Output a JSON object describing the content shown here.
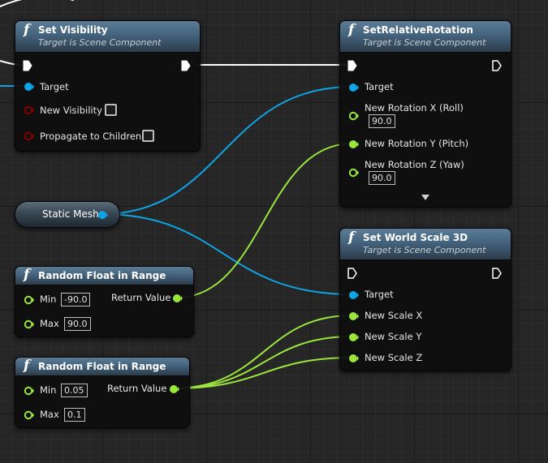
{
  "colors": {
    "object_pin": "#0da5e6",
    "float_pin": "#9ae63c",
    "bool_pin": "#8b0000",
    "exec_wire": "#ffffff",
    "header_blue": "#44637c"
  },
  "icons": {
    "function": "f",
    "exec_pin": "exec-arrow-icon",
    "expand": "chevron-down-icon"
  },
  "nodes": {
    "set_visibility": {
      "title": "Set Visibility",
      "subtitle": "Target is Scene Component",
      "target_label": "Target",
      "new_visibility_label": "New Visibility",
      "new_visibility_checked": false,
      "propagate_label": "Propagate to Children",
      "propagate_checked": false
    },
    "set_relative_rotation": {
      "title": "SetRelativeRotation",
      "subtitle": "Target is Scene Component",
      "target_label": "Target",
      "rot_x_label": "New Rotation X (Roll)",
      "rot_x_value": "90.0",
      "rot_y_label": "New Rotation Y (Pitch)",
      "rot_z_label": "New Rotation Z (Yaw)",
      "rot_z_value": "90.0"
    },
    "static_mesh": {
      "label": "Static Mesh"
    },
    "set_world_scale": {
      "title": "Set World Scale 3D",
      "subtitle": "Target is Scene Component",
      "target_label": "Target",
      "scale_x_label": "New Scale X",
      "scale_y_label": "New Scale Y",
      "scale_z_label": "New Scale Z"
    },
    "random_float_1": {
      "title": "Random Float in Range",
      "min_label": "Min",
      "min_value": "-90.0",
      "max_label": "Max",
      "max_value": "90.0",
      "return_label": "Return Value"
    },
    "random_float_2": {
      "title": "Random Float in Range",
      "min_label": "Min",
      "min_value": "0.05",
      "max_label": "Max",
      "max_value": "0.1",
      "return_label": "Return Value"
    }
  }
}
